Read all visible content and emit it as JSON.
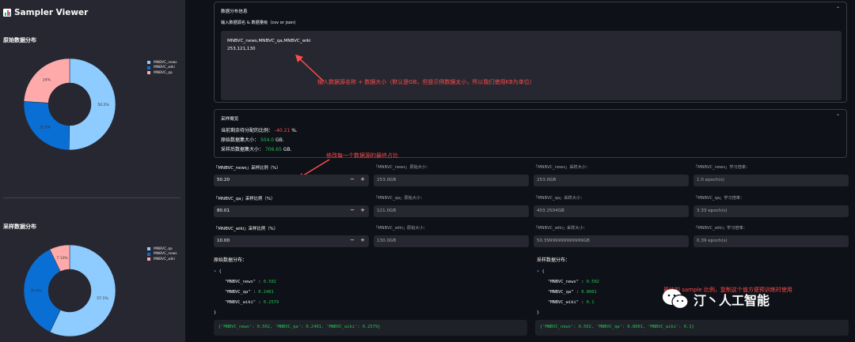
{
  "sidebar": {
    "title": "Sampler Viewer",
    "orig_heading": "原始数据分布",
    "sample_heading": "采样数据分布",
    "orig_pie": {
      "legend": [
        {
          "label": "MNBVC_news",
          "color": "#8ecbff"
        },
        {
          "label": "MNBVC_wiki",
          "color": "#0a6fd4"
        },
        {
          "label": "MNBVC_qa",
          "color": "#ffaaaa"
        }
      ],
      "labels": [
        "50.2%",
        "25.8%",
        "24%"
      ]
    },
    "sample_pie": {
      "legend": [
        {
          "label": "MNBVC_qa",
          "color": "#8ecbff"
        },
        {
          "label": "MNBVC_news",
          "color": "#0a6fd4"
        },
        {
          "label": "MNBVC_wiki",
          "color": "#ffaaaa"
        }
      ],
      "labels": [
        "57.1%",
        "35.8%",
        "7.13%"
      ]
    }
  },
  "info_expander": {
    "title": "数据分布信息",
    "input_label": "输入数据源名 & 数据量级（csv or json)",
    "line1": "MNBVC_news,MNBVC_qa,MNBVC_wiki",
    "line2": "253,121,130",
    "annotation": "输入数据源名称 + 数据大小（默认是GB，但是示例数据太小，所以我们使用KB为单位）"
  },
  "summary_expander": {
    "title": "采样概览",
    "ratio_label": "当前剩余待分配的比例：",
    "ratio_value": "-40.21",
    "ratio_unit": "%.",
    "orig_size_label": "原始数据集大小：",
    "orig_size_value": "504.0",
    "orig_size_unit": "GB.",
    "sample_size_label": "采样后数据集大小：",
    "sample_size_value": "706.65",
    "sample_size_unit": "GB."
  },
  "annotation_ratio": "修改每一个数据源的最终占比",
  "rows": [
    {
      "ratio_label": "「MNBVC_news」采样比例（%）",
      "ratio": "50.20",
      "orig_label": "「MNBVC_news」原始大小：",
      "orig": "253.0GB",
      "sample_label": "「MNBVC_news」采样大小：",
      "sample": "253.0GB",
      "epoch_label": "「MNBVC_news」学习倍率：",
      "epoch": "1.0 epoch(s)"
    },
    {
      "ratio_label": "「MNBVC_qa」采样比例（%）",
      "ratio": "80.01",
      "orig_label": "「MNBVC_qa」原始大小：",
      "orig": "121.0GB",
      "sample_label": "「MNBVC_qa」采样大小：",
      "sample": "403.2504GB",
      "epoch_label": "「MNBVC_qa」学习倍率：",
      "epoch": "3.33 epoch(s)"
    },
    {
      "ratio_label": "「MNBVC_wiki」采样比例（%）",
      "ratio": "10.00",
      "orig_label": "「MNBVC_wiki」原始大小：",
      "orig": "130.0GB",
      "sample_label": "「MNBVC_wiki」采样大小：",
      "sample": "50.39999999999999GB",
      "epoch_label": "「MNBVC_wiki」学习倍率：",
      "epoch": "0.39 epoch(s)"
    }
  ],
  "orig_dist": {
    "heading": "原始数据分布：",
    "entries": [
      {
        "key": "\"MNBVC_news\"",
        "value": "0.502"
      },
      {
        "key": "\"MNBVC_qa\"",
        "value": "0.2401"
      },
      {
        "key": "\"MNBVC_wiki\"",
        "value": "0.2579"
      }
    ],
    "code": "{'MNBVC_news': 0.502, 'MNBVC_qa': 0.2401, 'MNBVC_wiki': 0.2579}"
  },
  "sample_dist": {
    "heading": "采样数据分布：",
    "entries": [
      {
        "key": "\"MNBVC_news\"",
        "value": "0.502"
      },
      {
        "key": "\"MNBVC_qa\"",
        "value": "0.8001"
      },
      {
        "key": "\"MNBVC_wiki\"",
        "value": "0.1"
      }
    ],
    "code": "{'MNBVC_news': 0.502, 'MNBVC_qa': 0.8001, 'MNBVC_wiki': 0.1}"
  },
  "annotation_sample": "最终的 sample 比例，复制这个值方便预训练时使用",
  "watermark": "汀丶人工智能",
  "chart_data": [
    {
      "type": "pie",
      "title": "原始数据分布",
      "categories": [
        "MNBVC_news",
        "MNBVC_wiki",
        "MNBVC_qa"
      ],
      "values": [
        50.2,
        25.8,
        24.0
      ]
    },
    {
      "type": "pie",
      "title": "采样数据分布",
      "categories": [
        "MNBVC_qa",
        "MNBVC_news",
        "MNBVC_wiki"
      ],
      "values": [
        57.1,
        35.8,
        7.13
      ]
    }
  ]
}
